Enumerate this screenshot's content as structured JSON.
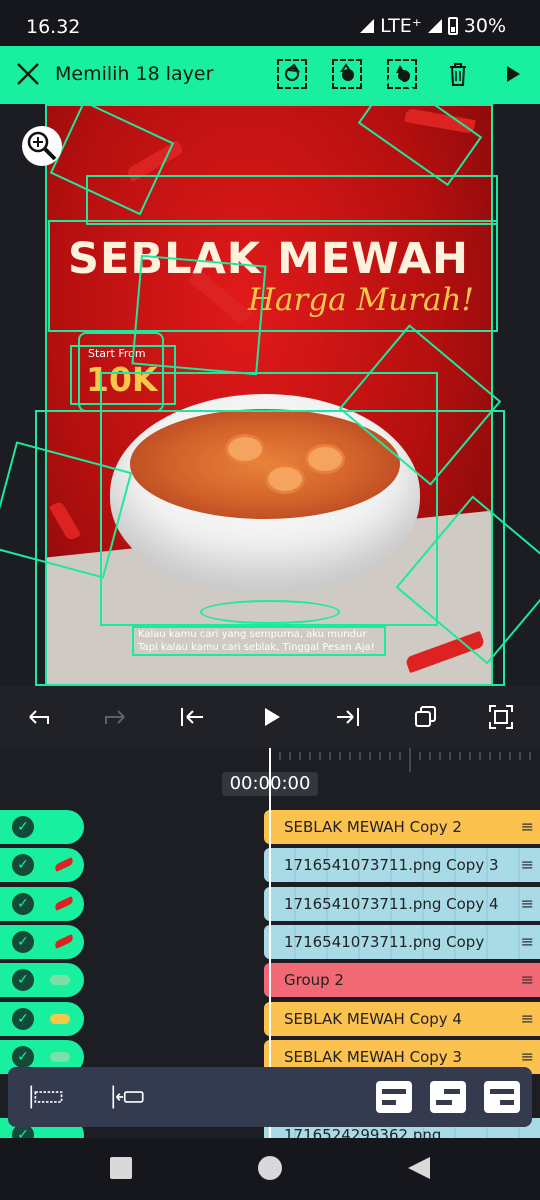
{
  "status": {
    "time": "16.32",
    "network": "LTE⁺",
    "battery": "30%"
  },
  "toolbar": {
    "title": "Memilih 18 layer"
  },
  "poster": {
    "headline": "SEBLAK MEWAH",
    "subhead": "Harga Murah!",
    "start_from": "Start From",
    "price": "10K",
    "caption_line1": "Kalau kamu cari yang sempurna, aku mundur",
    "caption_line2": "Tapi kalau kamu cari seblak, Tinggal Pesan Aja!"
  },
  "timeline": {
    "timecode": "00:00:00",
    "layers": [
      {
        "label": "SEBLAK MEWAH Copy 2",
        "color": "orange"
      },
      {
        "label": "1716541073711.png Copy 3",
        "color": "blue"
      },
      {
        "label": "1716541073711.png Copy 4",
        "color": "blue"
      },
      {
        "label": "1716541073711.png Copy",
        "color": "blue"
      },
      {
        "label": "Group 2",
        "color": "red"
      },
      {
        "label": "SEBLAK MEWAH Copy 4",
        "color": "orange"
      },
      {
        "label": "SEBLAK MEWAH Copy 3",
        "color": "orange"
      },
      {
        "label": "1716524299362.png",
        "color": "blue"
      }
    ],
    "menu_glyph": "≡"
  },
  "colors": {
    "accent": "#18f0a0",
    "poster_red": "#c8161a",
    "clip_orange": "#fbc24f",
    "clip_blue": "#a9dbe6",
    "clip_red": "#f06975"
  }
}
